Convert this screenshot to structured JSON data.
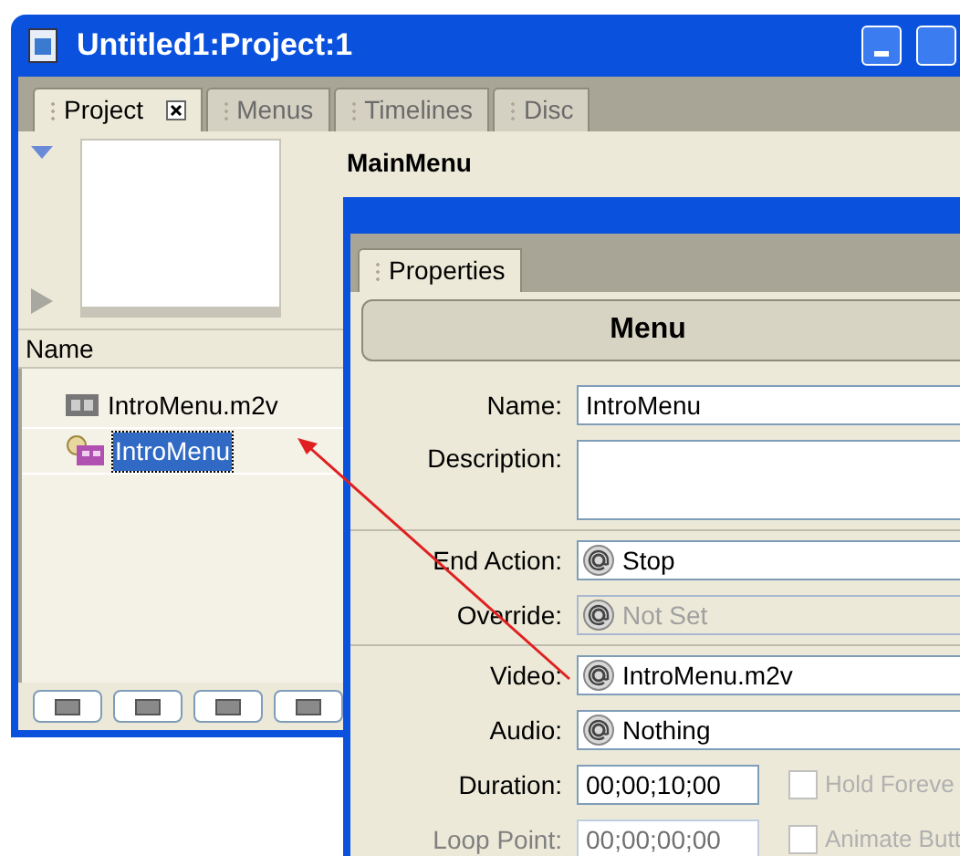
{
  "window": {
    "title": "Untitled1:Project:1"
  },
  "tabs": [
    {
      "label": "Project",
      "selected": true,
      "closable": true
    },
    {
      "label": "Menus",
      "selected": false,
      "closable": false
    },
    {
      "label": "Timelines",
      "selected": false,
      "closable": false
    },
    {
      "label": "Disc",
      "selected": false,
      "closable": false
    }
  ],
  "project_panel": {
    "column_header": "Name",
    "items": [
      {
        "label": "IntroMenu.m2v",
        "kind": "video",
        "selected": false
      },
      {
        "label": "IntroMenu",
        "kind": "menu",
        "selected": true
      }
    ]
  },
  "main_heading": "MainMenu",
  "properties": {
    "tab": "Properties",
    "header": "Menu",
    "groups": [
      [
        {
          "label": "Name:",
          "kind": "text",
          "value": "IntroMenu"
        },
        {
          "label": "Description:",
          "kind": "textarea"
        }
      ],
      [
        {
          "label": "End Action:",
          "kind": "dropdown",
          "value": "Stop",
          "disabled": false
        },
        {
          "label": "Override:",
          "kind": "dropdown",
          "value": "Not Set",
          "disabled": true
        }
      ],
      [
        {
          "label": "Video:",
          "kind": "dropdown",
          "value": "IntroMenu.m2v",
          "disabled": false
        },
        {
          "label": "Audio:",
          "kind": "dropdown",
          "value": "Nothing",
          "disabled": false
        },
        {
          "label": "Duration:",
          "kind": "timecode",
          "value": "00;00;10;00",
          "faded": false,
          "checkbox": {
            "label": "Hold Foreve",
            "checked": false
          }
        },
        {
          "label": "Loop Point:",
          "kind": "timecode",
          "value": "00;00;00;00",
          "faded": true,
          "checkbox": {
            "label": "Animate Butt",
            "checked": false
          }
        }
      ]
    ]
  }
}
